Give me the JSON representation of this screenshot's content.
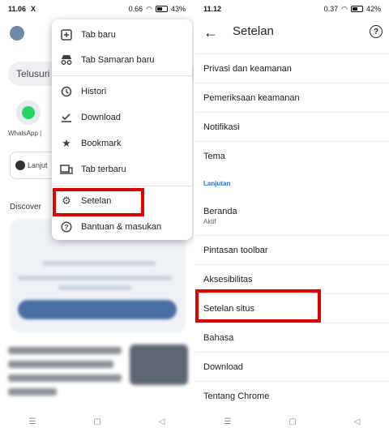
{
  "left_status": {
    "time": "11.06",
    "x_icon": "X",
    "speed": "0.66",
    "battery": "43%"
  },
  "right_status": {
    "time": "11.12",
    "speed": "0.37",
    "battery": "42%"
  },
  "left_background": {
    "search_placeholder": "Telusuri a",
    "whatsapp_label": "WhatsApp |",
    "lanjut_label": "Lanjut",
    "discover_label": "Discover"
  },
  "menu": {
    "items": [
      {
        "label": "Tab baru",
        "icon": "plus-square-icon"
      },
      {
        "label": "Tab Samaran baru",
        "icon": "incognito-icon"
      },
      {
        "label": "Histori",
        "icon": "history-icon"
      },
      {
        "label": "Download",
        "icon": "download-icon"
      },
      {
        "label": "Bookmark",
        "icon": "star-icon"
      },
      {
        "label": "Tab terbaru",
        "icon": "devices-icon"
      },
      {
        "label": "Setelan",
        "icon": "gear-icon"
      },
      {
        "label": "Bantuan & masukan",
        "icon": "help-icon"
      }
    ]
  },
  "settings": {
    "title": "Setelan",
    "rows": [
      {
        "label": "Privasi dan keamanan"
      },
      {
        "label": "Pemeriksaan keamanan"
      },
      {
        "label": "Notifikasi"
      },
      {
        "label": "Tema"
      }
    ],
    "section_label": "Lanjutan",
    "advanced_rows": [
      {
        "label": "Beranda",
        "sub": "Aktif"
      },
      {
        "label": "Pintasan toolbar"
      },
      {
        "label": "Aksesibilitas"
      },
      {
        "label": "Setelan situs"
      },
      {
        "label": "Bahasa"
      },
      {
        "label": "Download"
      },
      {
        "label": "Tentang Chrome"
      }
    ]
  },
  "highlight_color": "#e00000"
}
